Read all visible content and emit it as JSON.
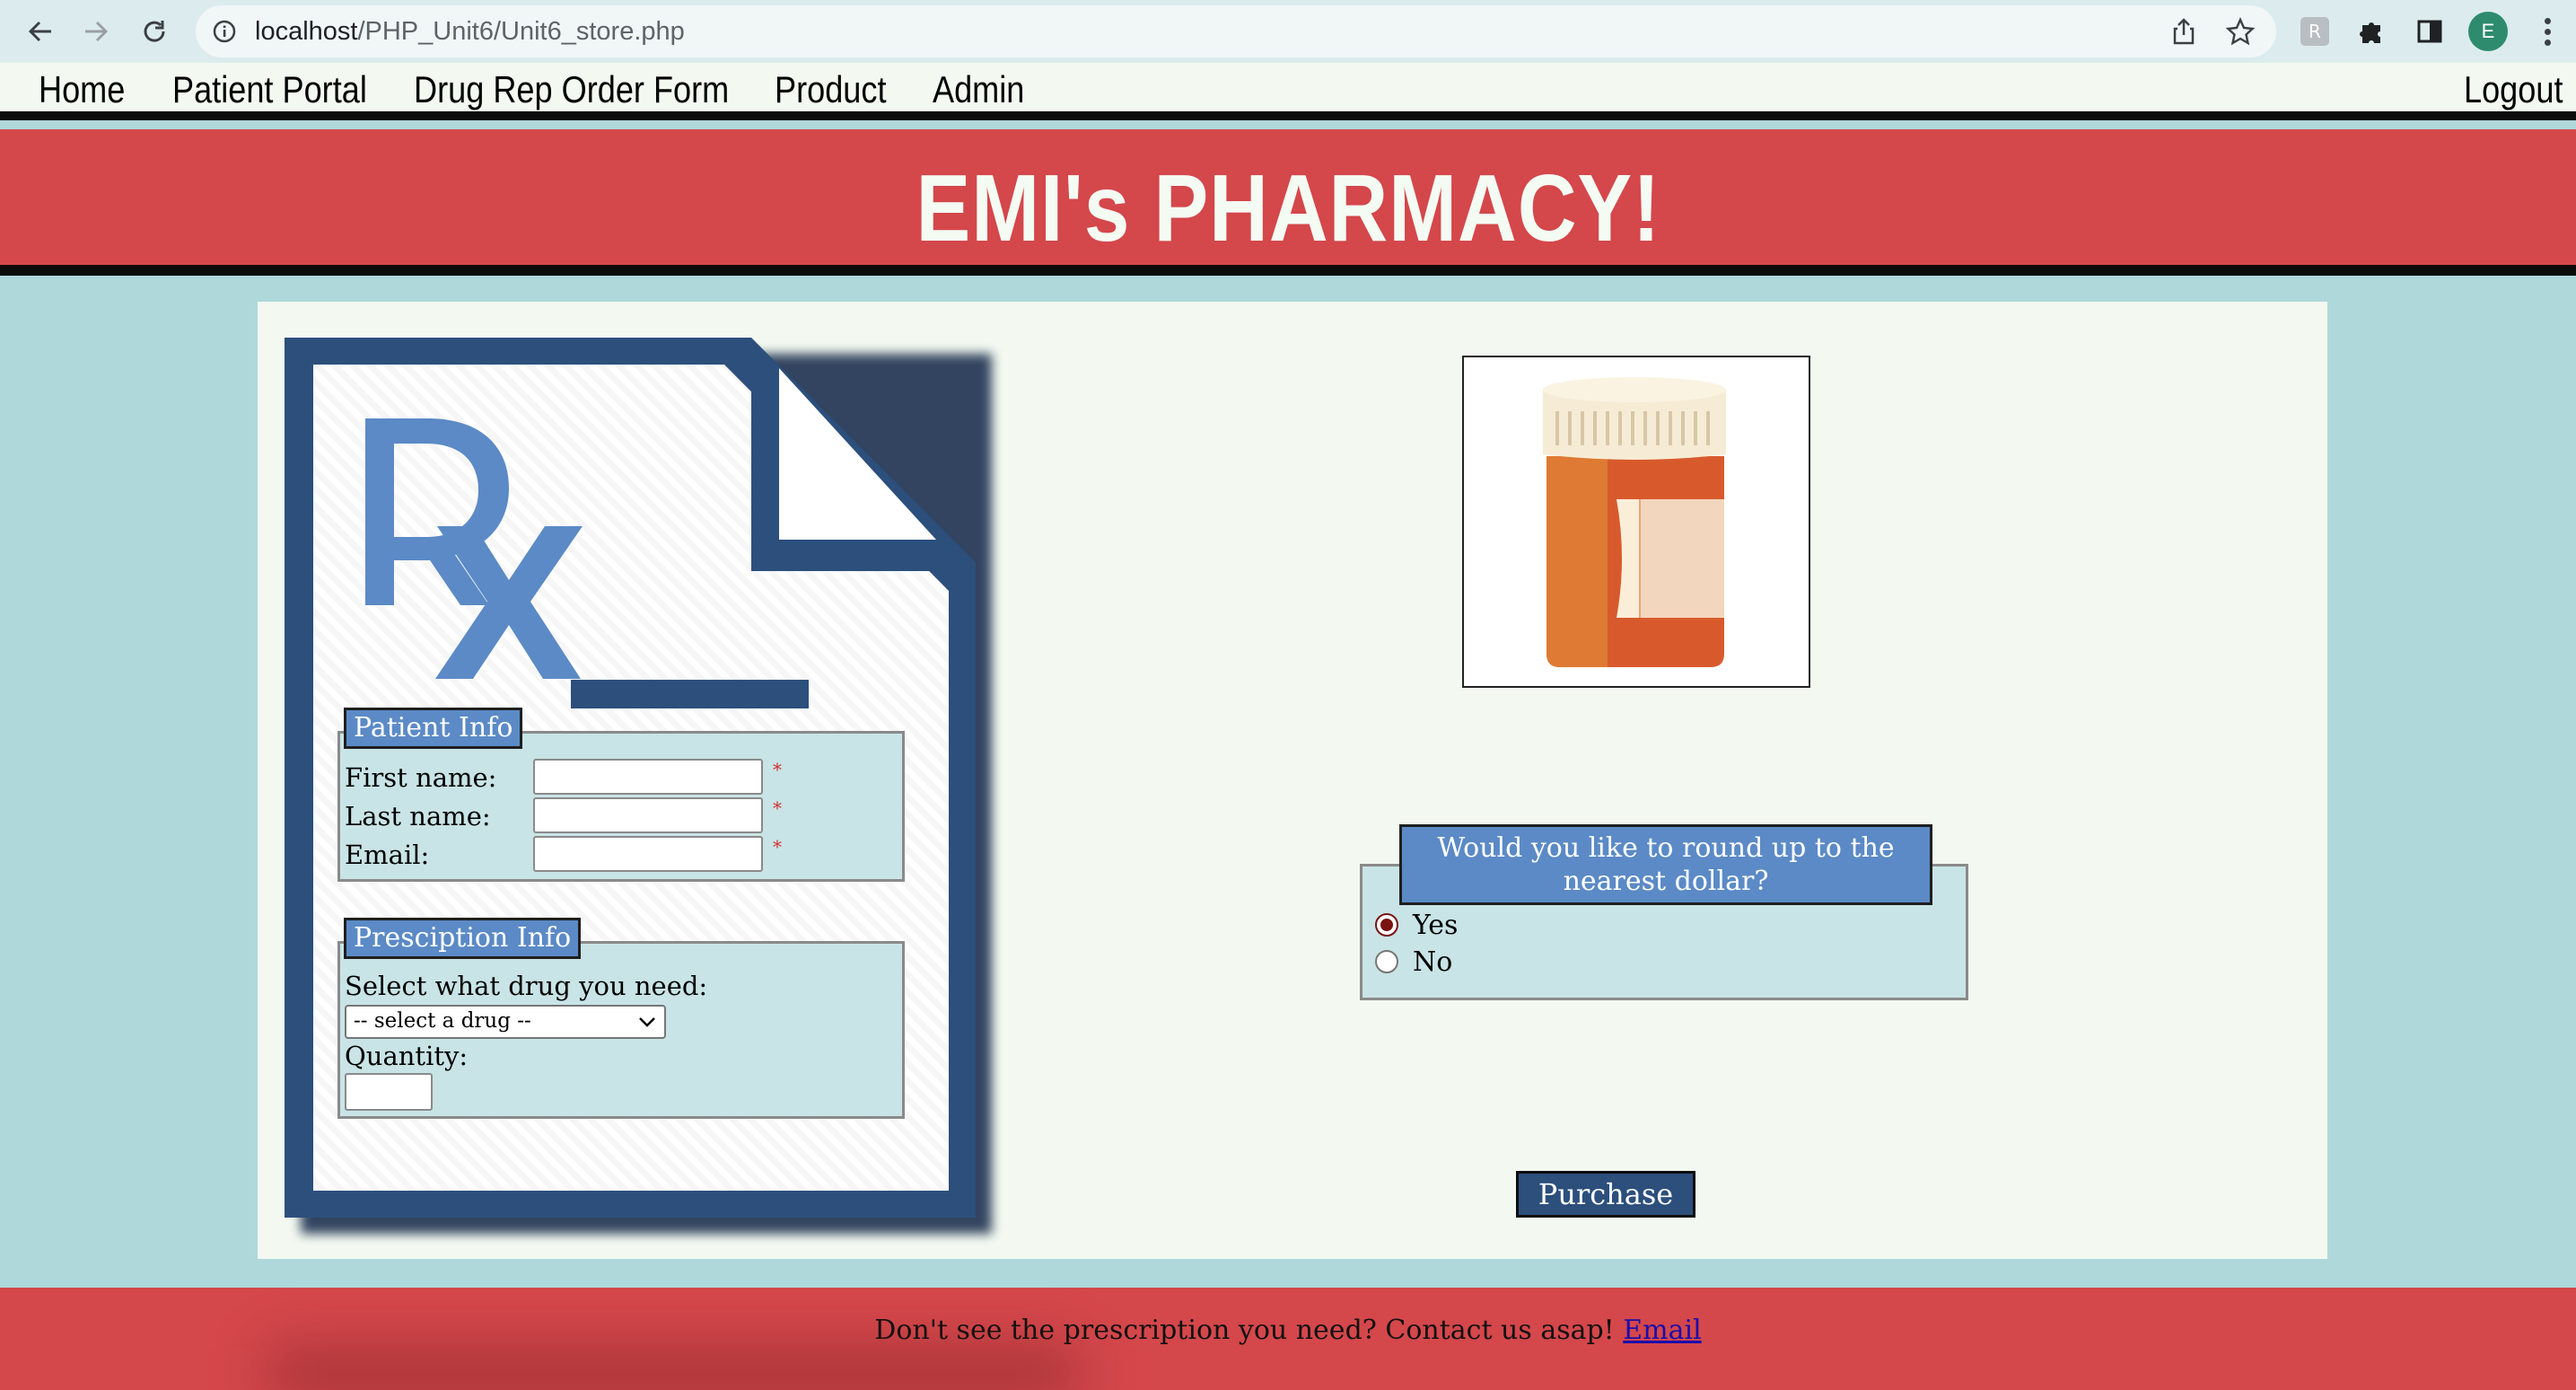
{
  "browser": {
    "url_host": "localhost",
    "url_path": "/PHP_Unit6/Unit6_store.php",
    "profile_initial": "E",
    "icons": [
      "back-icon",
      "forward-icon",
      "reload-icon",
      "info-icon",
      "share-icon",
      "star-icon",
      "extension-icon",
      "puzzle-icon",
      "sidepanel-icon",
      "menu-icon"
    ]
  },
  "nav": {
    "items": [
      {
        "label": "Home"
      },
      {
        "label": "Patient Portal"
      },
      {
        "label": "Drug Rep Order Form"
      },
      {
        "label": "Product"
      },
      {
        "label": "Admin"
      }
    ],
    "logout": "Logout"
  },
  "header": {
    "title": "EMI's PHARMACY!"
  },
  "patient_info": {
    "legend": "Patient Info",
    "first_name_label": "First name:",
    "last_name_label": "Last name:",
    "email_label": "Email:",
    "required_mark": "*",
    "first_name_value": "",
    "last_name_value": "",
    "email_value": ""
  },
  "prescription_info": {
    "legend": "Presciption Info",
    "select_label": "Select what drug you need:",
    "select_value": "-- select a drug --",
    "quantity_label": "Quantity:",
    "quantity_value": ""
  },
  "round_up": {
    "question": "Would you like to round up to the nearest dollar?",
    "options": [
      {
        "label": "Yes",
        "checked": true
      },
      {
        "label": "No",
        "checked": false
      }
    ]
  },
  "purchase_label": "Purchase",
  "footer": {
    "text": "Don't see the prescription you need? Contact us asap! ",
    "link": "Email"
  },
  "colors": {
    "page_bg": "#afd8db",
    "banner_red": "#d4474b",
    "panel_bg": "#f3f9f1",
    "legend_blue": "#5b8ac6",
    "doc_navy": "#2c4f7c",
    "fieldset_bg": "#c9e4e6"
  }
}
